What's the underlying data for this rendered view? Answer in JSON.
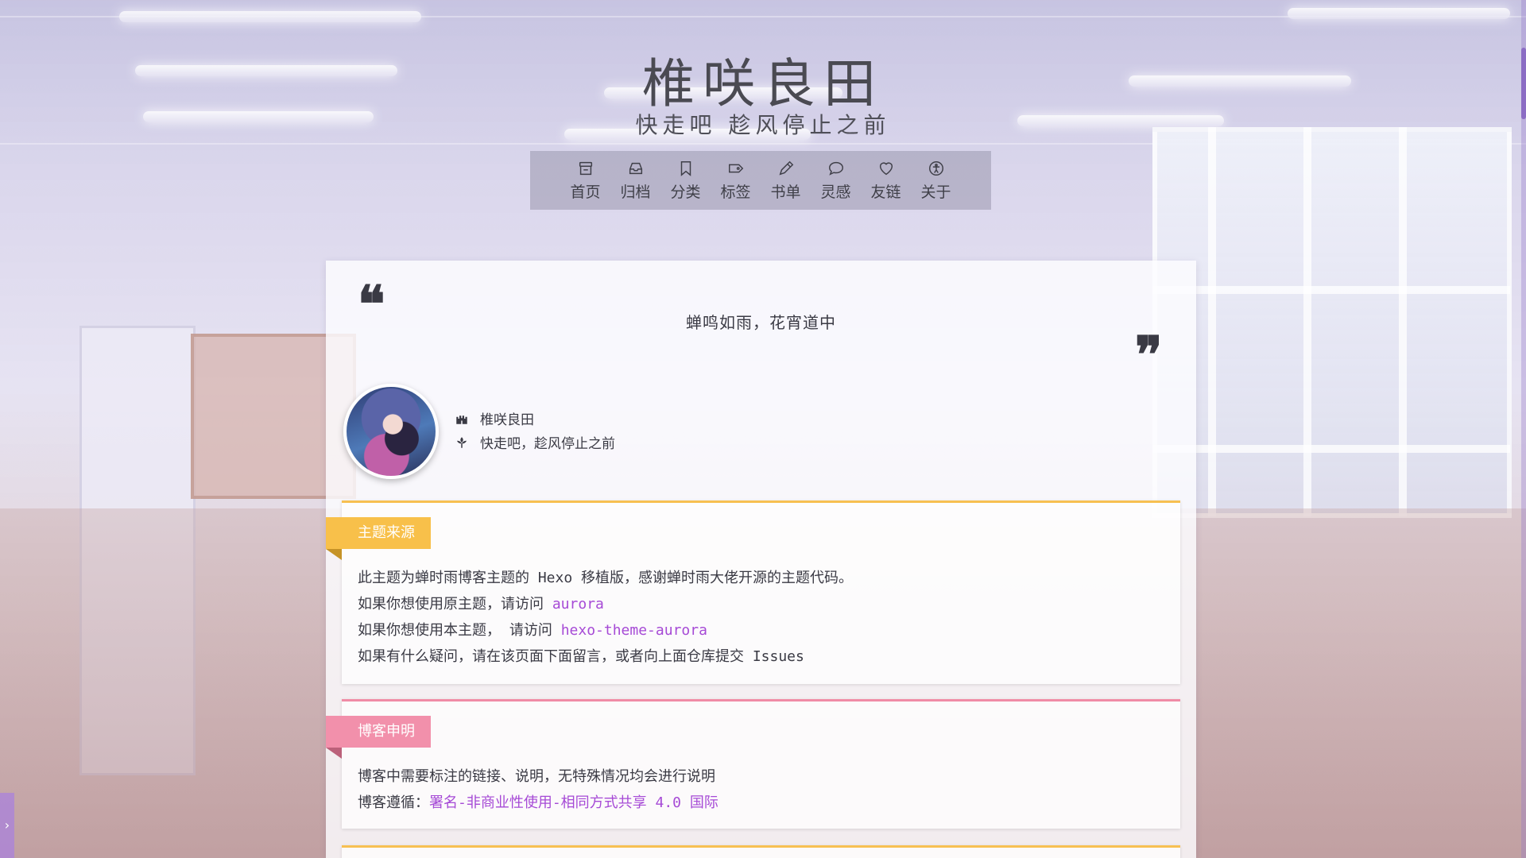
{
  "site": {
    "title": "椎咲良田",
    "subtitle": "快走吧  趁风停止之前"
  },
  "nav": {
    "items": [
      {
        "label": "首页",
        "icon": "home-icon"
      },
      {
        "label": "归档",
        "icon": "inbox-icon"
      },
      {
        "label": "分类",
        "icon": "bookmark-icon"
      },
      {
        "label": "标签",
        "icon": "tag-icon"
      },
      {
        "label": "书单",
        "icon": "pen-icon"
      },
      {
        "label": "灵感",
        "icon": "chat-bubble-icon"
      },
      {
        "label": "友链",
        "icon": "heart-icon"
      },
      {
        "label": "关于",
        "icon": "accessibility-icon"
      }
    ]
  },
  "quote": {
    "text": "蝉鸣如雨，花宵道中"
  },
  "profile": {
    "name": "椎咲良田",
    "motto": "快走吧，趁风停止之前"
  },
  "panels": {
    "theme_source": {
      "label": "主题来源",
      "line1": "此主题为蝉时雨博客主题的 Hexo 移植版，感谢蝉时雨大佬开源的主题代码。",
      "line2_prefix": "如果你想使用原主题，请访问 ",
      "line2_link": "aurora",
      "line3_prefix": "如果你想使用本主题，  请访问 ",
      "line3_link": "hexo-theme-aurora",
      "line4": "如果有什么疑问，请在该页面下面留言，或者向上面仓库提交 Issues"
    },
    "blog_statement": {
      "label": "博客申明",
      "line1": "博客中需要标注的链接、说明，无特殊情况均会进行说明",
      "line2_prefix": "博客遵循：",
      "line2_link": "署名-非商业性使用-相同方式共享 4.0 国际"
    }
  },
  "sidebar_toggle": {
    "glyph": "›"
  },
  "colors": {
    "accent_link": "#a64ad6",
    "label_yellow": "#f8c04a",
    "label_pink": "#f290ab"
  }
}
